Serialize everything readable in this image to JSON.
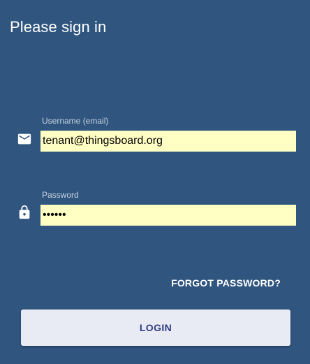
{
  "header": {
    "title": "Please sign in"
  },
  "form": {
    "username": {
      "label": "Username (email)",
      "value": "tenant@thingsboard.org",
      "icon": "email-icon"
    },
    "password": {
      "label": "Password",
      "value": "tenant",
      "icon": "lock-icon"
    },
    "forgot_password_label": "FORGOT PASSWORD?",
    "login_label": "LOGIN"
  },
  "colors": {
    "background": "#305680",
    "input_background": "#ffffc4",
    "button_background": "#e9ebf4",
    "button_text": "#2e3a82"
  }
}
